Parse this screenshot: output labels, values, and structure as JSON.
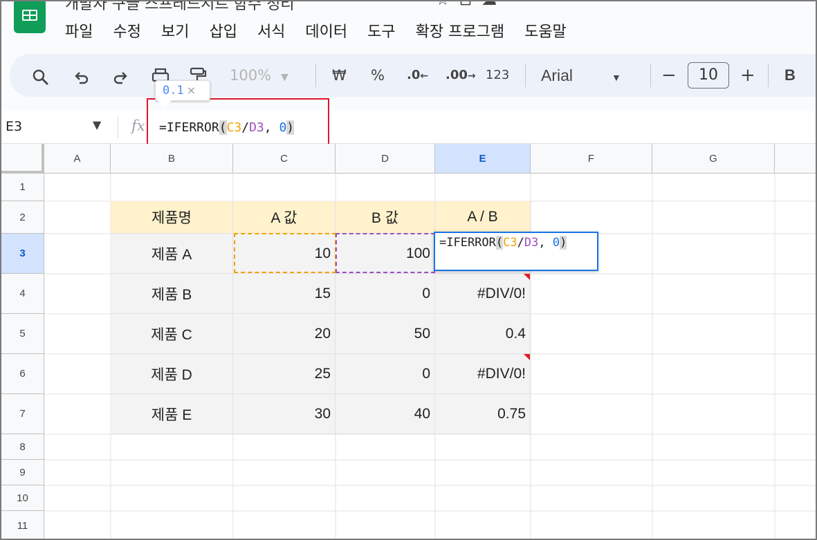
{
  "app": {
    "title": "개발자 구글 스프레드시트 함수 정리",
    "menu": [
      "파일",
      "수정",
      "보기",
      "삽입",
      "서식",
      "데이터",
      "도구",
      "확장 프로그램",
      "도움말"
    ]
  },
  "toolbar": {
    "zoom": "100%",
    "currency": "₩",
    "percent": "%",
    "dec_decrease": ".0",
    "dec_increase": ".00",
    "number_format": "123",
    "font": "Arial",
    "font_size": "10",
    "minus": "−",
    "plus": "+",
    "bold": "B"
  },
  "tooltip": {
    "value": "0.1",
    "close": "×"
  },
  "formula_bar": {
    "name_box": "E3",
    "fx": "fx",
    "formula": {
      "prefix": "=IFERROR",
      "open": "(",
      "ref1": "C3",
      "slash": "/",
      "ref2": "D3",
      "comma": ", ",
      "zero": "0",
      "close": ")"
    }
  },
  "grid": {
    "columns": [
      "A",
      "B",
      "C",
      "D",
      "E",
      "F",
      "G"
    ],
    "rows": [
      "1",
      "2",
      "3",
      "4",
      "5",
      "6",
      "7",
      "8",
      "9",
      "10",
      "11"
    ],
    "selected_cell": "E3",
    "header": [
      "제품명",
      "A 값",
      "B 값",
      "A / B"
    ],
    "data": [
      [
        "제품 A",
        "10",
        "100",
        ""
      ],
      [
        "제품 B",
        "15",
        "0",
        "#DIV/0!"
      ],
      [
        "제품 C",
        "20",
        "50",
        "0.4"
      ],
      [
        "제품 D",
        "25",
        "0",
        "#DIV/0!"
      ],
      [
        "제품 E",
        "30",
        "40",
        "0.75"
      ]
    ]
  },
  "colors": {
    "header_fill": "#fff2cc",
    "body_fill": "#f3f3f3",
    "selection_blue": "#1a73e8",
    "ref_c3": "#f0a202",
    "ref_d3": "#9c4ec2",
    "highlight_red": "#e0142a"
  }
}
